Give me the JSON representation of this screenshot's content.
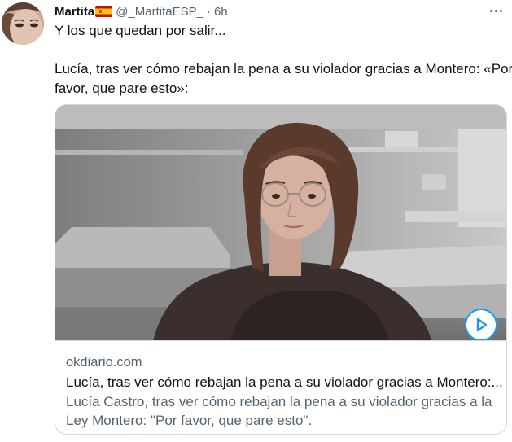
{
  "tweet": {
    "author": {
      "display_name": "Martita",
      "flag_icon": "spain-flag-icon",
      "handle": "@_MartitaESP_",
      "separator": "·",
      "time": "6h"
    },
    "more_icon": "more-horizontal-icon",
    "text": {
      "line1": "Y los que quedan por salir...",
      "line2": "Lucía, tras ver cómo rebajan la pena a su violador gracias a Montero: «Por",
      "line3": "favor, que pare esto»:"
    },
    "card": {
      "domain": "okdiario.com",
      "title": "Lucía, tras ver cómo rebajan la pena a su violador gracias a Montero:...",
      "description_line1": "Lucía Castro, tras ver cómo rebajan la pena a su violador gracias a la",
      "description_line2": "Ley Montero: \"Por favor, que pare esto\".",
      "play_icon": "play-icon"
    }
  },
  "colors": {
    "text_primary": "#0f1419",
    "text_secondary": "#536471",
    "border": "#cfd9de",
    "accent": "#1d9bf0"
  }
}
